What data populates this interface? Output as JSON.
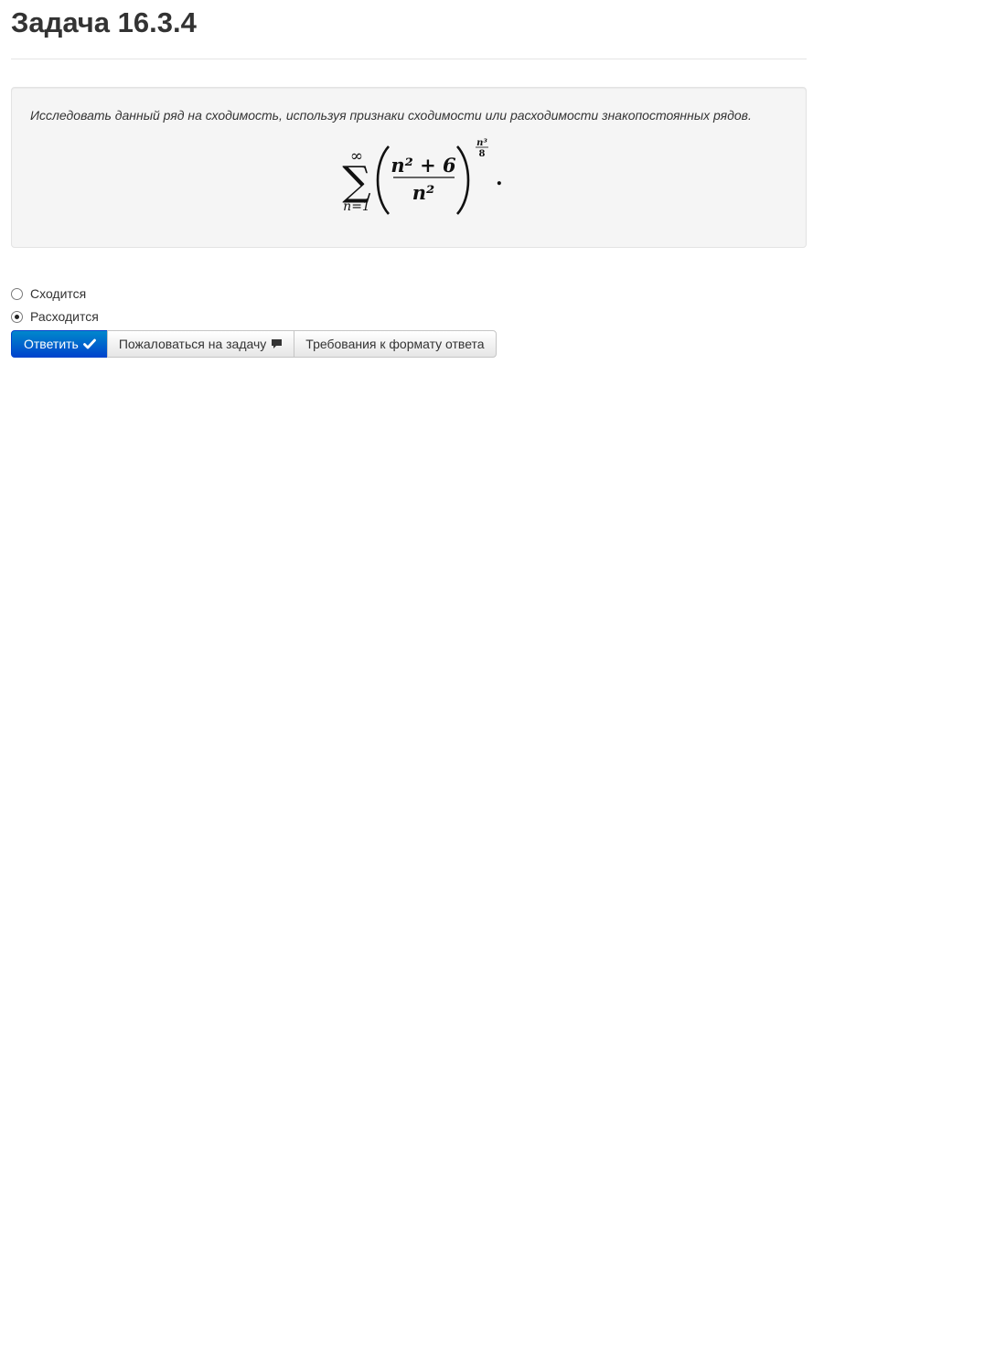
{
  "page": {
    "title": "Задача 16.3.4"
  },
  "problem": {
    "statement": "Исследовать данный ряд на сходимость, используя признаки сходимости или расходимости знакопостоянных рядов.",
    "formula": {
      "sum_upper": "∞",
      "sum_lower": "n=1",
      "numerator": "n² + 6",
      "denominator": "n²",
      "exponent_numerator": "n³",
      "exponent_denominator": "8",
      "terminal": "."
    }
  },
  "answer": {
    "options": [
      {
        "label": "Сходится",
        "selected": false
      },
      {
        "label": "Расходится",
        "selected": true
      }
    ]
  },
  "buttons": {
    "submit": {
      "label": "Ответить",
      "icon": "checkmark-icon",
      "color": "#0055cc"
    },
    "complain": {
      "label": "Пожаловаться на задачу",
      "icon": "comment-icon"
    },
    "format": {
      "label": "Требования к формату ответа"
    }
  }
}
